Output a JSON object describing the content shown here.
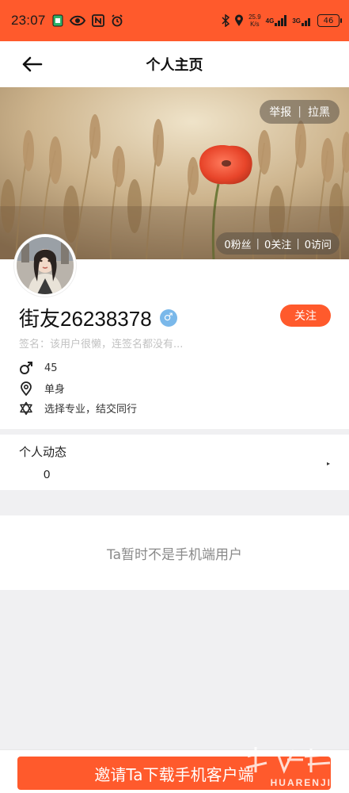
{
  "status_bar": {
    "time": "23:07",
    "net_speed_value": "25.9",
    "net_speed_unit": "K/s",
    "signal_1": "4G",
    "signal_2": "3G",
    "battery": "46",
    "icons": [
      "app-notification-icon",
      "eye-icon",
      "nfc-icon",
      "alarm-icon",
      "bluetooth-icon",
      "location-icon",
      "signal-icon",
      "battery-icon"
    ]
  },
  "header": {
    "title": "个人主页",
    "back_icon": "arrow-left-icon"
  },
  "banner": {
    "report_label": "举报",
    "block_label": "拉黑",
    "fans": "0粉丝",
    "following": "0关注",
    "visits": "0访问"
  },
  "profile": {
    "name": "街友26238378",
    "gender_symbol": "♂",
    "follow_label": "关注",
    "signature": "签名：该用户很懒，连签名都没有...",
    "age": "45",
    "relationship": "单身",
    "career": "选择专业，结交同行"
  },
  "dynamics": {
    "title": "个人动态",
    "count": "0",
    "arrow": "▸"
  },
  "notice": {
    "text": "Ta暂时不是手机端用户"
  },
  "bottom": {
    "invite_label": "邀请Ta下载手机客户端"
  },
  "watermark": {
    "text": "HUARENJIE"
  },
  "colors": {
    "accent": "#ff5a2c",
    "badge_blue": "#7ab8ea",
    "background": "#f0f0f2"
  }
}
